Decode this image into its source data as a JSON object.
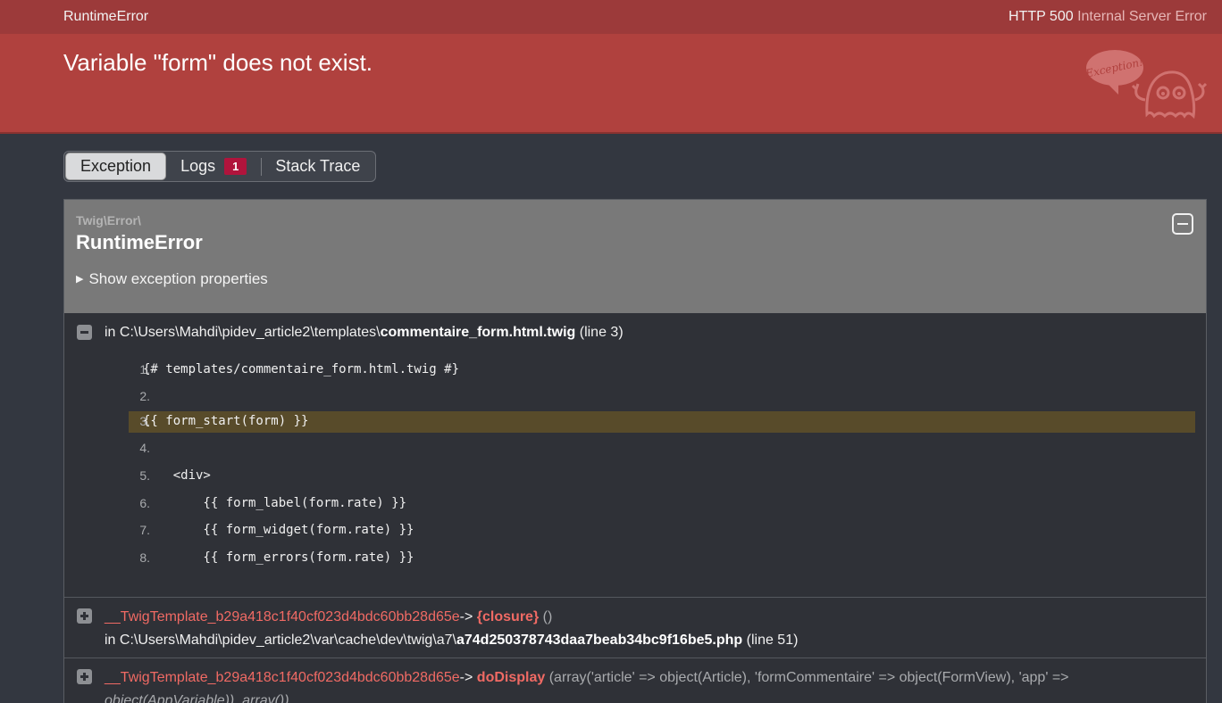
{
  "header": {
    "exception_class": "RuntimeError",
    "status_code": "HTTP 500",
    "status_text": "Internal Server Error"
  },
  "banner": {
    "message": "Variable \"form\" does not exist.",
    "ghost_text": "Exception!"
  },
  "tabs": [
    {
      "label": "Exception",
      "active": true
    },
    {
      "label": "Logs",
      "badge": "1"
    },
    {
      "label": "Stack Trace"
    }
  ],
  "exception": {
    "namespace": "Twig\\Error\\",
    "class": "RuntimeError",
    "show_props_label": "Show exception properties"
  },
  "trace_main": {
    "prefix": "in C:\\Users\\Mahdi\\pidev_article2\\templates\\",
    "file": "commentaire_form.html.twig",
    "line": "(line 3)",
    "code": [
      {
        "num": "1.",
        "text": "{# templates/commentaire_form.html.twig #}"
      },
      {
        "num": "2.",
        "text": ""
      },
      {
        "num": "3.",
        "text": "{{ form_start(form) }}",
        "highlight": true
      },
      {
        "num": "4.",
        "text": ""
      },
      {
        "num": "5.",
        "text": "    <div>"
      },
      {
        "num": "6.",
        "text": "        {{ form_label(form.rate) }}"
      },
      {
        "num": "7.",
        "text": "        {{ form_widget(form.rate) }}"
      },
      {
        "num": "8.",
        "text": "        {{ form_errors(form.rate) }}"
      }
    ]
  },
  "trace_items": [
    {
      "class": "__TwigTemplate_b29a418c1f40cf023d4bdc60bb28d65e",
      "arrow": "->",
      "function": "{closure}",
      "args": "()",
      "file_prefix": "in C:\\Users\\Mahdi\\pidev_article2\\var\\cache\\dev\\twig\\a7\\",
      "file": "a74d250378743daa7beab34bc9f16be5.php",
      "line": "(line 51)"
    },
    {
      "class": "__TwigTemplate_b29a418c1f40cf023d4bdc60bb28d65e",
      "arrow": "->",
      "function": "doDisplay",
      "args_line1": "(array('article' => object(Article), 'formCommentaire' => object(FormView), 'app' =>",
      "args_line2": "object(AppVariable)), array())"
    }
  ],
  "colors": {
    "header_bg": "#9c3a3a",
    "banner_bg": "#b0413e",
    "page_bg": "#333740",
    "highlight_line": "#584b2a",
    "trace_class": "#f06a64",
    "badge_bg": "#b0143c"
  }
}
